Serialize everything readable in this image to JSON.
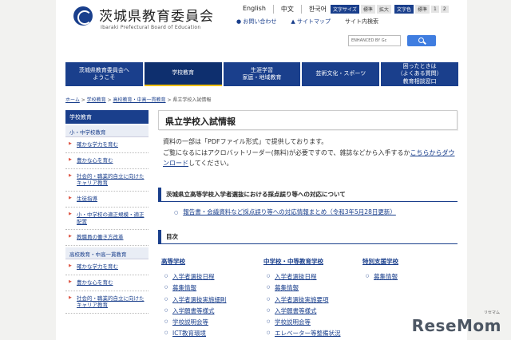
{
  "header": {
    "title": "茨城県教育委員会",
    "subtitle": "Ibaraki Prefectural Board of Education",
    "languages": [
      "English",
      "中文",
      "한국어"
    ],
    "font_size_label": "文字サイズ",
    "font_size_options": [
      "標準",
      "拡大"
    ],
    "color_label": "文字色",
    "color_options": [
      "標準",
      "1",
      "2"
    ],
    "contact_link": "お問い合わせ",
    "sitemap_link": "サイトマップ",
    "site_search": "サイト内検索",
    "search_placeholder": "ENHANCED BY Gc"
  },
  "nav": [
    "茨城県教育委員会へ\nようこそ",
    "学校教育",
    "生涯学習\n家庭・地域教育",
    "芸術文化・スポーツ",
    "困ったときは\n（よくある質問）\n教育相談窓口"
  ],
  "breadcrumb": [
    "ホーム",
    "学校教育",
    "高校教育・中高一貫教育",
    "県立学校入試情報"
  ],
  "sidebar": {
    "heading": "学校教育",
    "section1": "小・中学校教育",
    "items1": [
      "確かな学力を育む",
      "豊かな心を育む",
      "社会的・職業的自立に向けたキャリア教育",
      "生徒指導",
      "小・中学校の適正規模・適正配置",
      "教職員の働き方改革"
    ],
    "section2": "高校教育・中高一貫教育",
    "items2": [
      "確かな学力を育む",
      "豊かな心を育む",
      "社会的・職業的自立に向けたキャリア教育"
    ]
  },
  "main": {
    "title": "県立学校入試情報",
    "para1": "資料の一部は「PDFファイル形式」で提供しております。",
    "para2_a": "ご覧になるにはアクロバットリーダー(無料)が必要ですので、雑誌などから入手するか",
    "para2_link": "こちらからダウンロード",
    "para2_b": "してください。",
    "section1_heading": "茨城県立高等学校入学者選抜における採点誤り等への対応について",
    "report_link": "報告書・会議資料など採点誤り等への対応情報まとめ（令和3年5月28日更新）",
    "toc_heading": "目次",
    "columns": [
      {
        "heading": "高等学校",
        "items": [
          "入学者選抜日程",
          "募集情報",
          "入学者選抜実施細則",
          "入学願書等様式",
          "学校説明会等",
          "ICT教育環境"
        ]
      },
      {
        "heading": "中学校・中等教育学校",
        "items": [
          "入学者選抜日程",
          "募集情報",
          "入学者選抜実施要項",
          "入学願書等様式",
          "学校説明会等",
          "エレベーター等整備状況"
        ]
      },
      {
        "heading": "特別支援学校",
        "items": [
          "募集情報"
        ]
      }
    ]
  },
  "watermark": {
    "text": "ReseMom",
    "sub": "リセマム"
  },
  "colors": {
    "brand": "#1a3f8c",
    "nav_bg": "#1a3f8c",
    "search_button": "#3f7de0"
  }
}
